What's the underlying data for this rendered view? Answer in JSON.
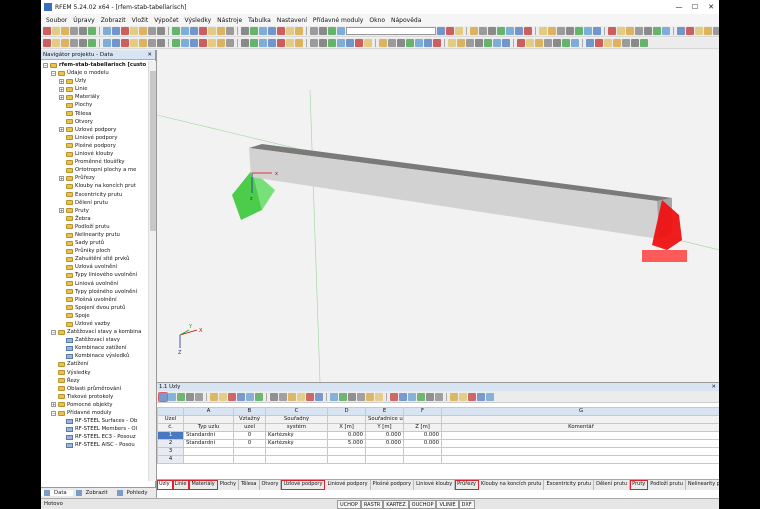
{
  "window": {
    "title": "RFEM 5.24.02 x64 - [rfem-stab-tabellarisch]",
    "min": "—",
    "max": "☐",
    "close": "✕"
  },
  "menu": [
    "Soubor",
    "Úpravy",
    "Zobrazit",
    "Vložit",
    "Výpočet",
    "Výsledky",
    "Nástroje",
    "Tabulka",
    "Nastavení",
    "Přídavné moduly",
    "Okno",
    "Nápověda"
  ],
  "navigator": {
    "title": "Navigátor projektu - Data",
    "items": [
      {
        "label": "rfem-stab-tabellarisch [custo",
        "level": 0,
        "exp": "−",
        "icon": "model",
        "bold": true
      },
      {
        "label": "Údaje o modelu",
        "level": 1,
        "exp": "−",
        "icon": "folder"
      },
      {
        "label": "Uzly",
        "level": 2,
        "exp": "+",
        "icon": "folder"
      },
      {
        "label": "Linie",
        "level": 2,
        "exp": "+",
        "icon": "folder"
      },
      {
        "label": "Materiály",
        "level": 2,
        "exp": "+",
        "icon": "folder"
      },
      {
        "label": "Plochy",
        "level": 2,
        "exp": "",
        "icon": "folder"
      },
      {
        "label": "Tělesa",
        "level": 2,
        "exp": "",
        "icon": "folder"
      },
      {
        "label": "Otvory",
        "level": 2,
        "exp": "",
        "icon": "folder"
      },
      {
        "label": "Uzlové podpory",
        "level": 2,
        "exp": "+",
        "icon": "folder"
      },
      {
        "label": "Liniové podpory",
        "level": 2,
        "exp": "",
        "icon": "folder"
      },
      {
        "label": "Plošné podpory",
        "level": 2,
        "exp": "",
        "icon": "folder"
      },
      {
        "label": "Liniové klouby",
        "level": 2,
        "exp": "",
        "icon": "folder"
      },
      {
        "label": "Proměnné tloušťky",
        "level": 2,
        "exp": "",
        "icon": "folder"
      },
      {
        "label": "Ortotropní plochy a me",
        "level": 2,
        "exp": "",
        "icon": "folder"
      },
      {
        "label": "Průřezy",
        "level": 2,
        "exp": "+",
        "icon": "folder"
      },
      {
        "label": "Klouby na koncích prut",
        "level": 2,
        "exp": "",
        "icon": "folder"
      },
      {
        "label": "Excentricity prutu",
        "level": 2,
        "exp": "",
        "icon": "folder"
      },
      {
        "label": "Dělení prutu",
        "level": 2,
        "exp": "",
        "icon": "folder"
      },
      {
        "label": "Pruty",
        "level": 2,
        "exp": "+",
        "icon": "folder"
      },
      {
        "label": "Žebra",
        "level": 2,
        "exp": "",
        "icon": "folder"
      },
      {
        "label": "Podloží prutu",
        "level": 2,
        "exp": "",
        "icon": "folder"
      },
      {
        "label": "Nelinearity prutu",
        "level": 2,
        "exp": "",
        "icon": "folder"
      },
      {
        "label": "Sady prutů",
        "level": 2,
        "exp": "",
        "icon": "folder"
      },
      {
        "label": "Průniky ploch",
        "level": 2,
        "exp": "",
        "icon": "folder"
      },
      {
        "label": "Zahuštění sítě prvků",
        "level": 2,
        "exp": "",
        "icon": "folder"
      },
      {
        "label": "Uzlová uvolnění",
        "level": 2,
        "exp": "",
        "icon": "folder"
      },
      {
        "label": "Typy liniového uvolnění",
        "level": 2,
        "exp": "",
        "icon": "folder"
      },
      {
        "label": "Liniová uvolnění",
        "level": 2,
        "exp": "",
        "icon": "folder"
      },
      {
        "label": "Typy plošného uvolnění",
        "level": 2,
        "exp": "",
        "icon": "folder"
      },
      {
        "label": "Plošná uvolnění",
        "level": 2,
        "exp": "",
        "icon": "folder"
      },
      {
        "label": "Spojení dvou prutů",
        "level": 2,
        "exp": "",
        "icon": "folder"
      },
      {
        "label": "Spoje",
        "level": 2,
        "exp": "",
        "icon": "folder"
      },
      {
        "label": "Uzlové vazby",
        "level": 2,
        "exp": "",
        "icon": "folder"
      },
      {
        "label": "Zatěžovací stavy a kombina",
        "level": 1,
        "exp": "−",
        "icon": "folder"
      },
      {
        "label": "Zatěžovací stavy",
        "level": 2,
        "exp": "",
        "icon": "item"
      },
      {
        "label": "Kombinace zatížení",
        "level": 2,
        "exp": "",
        "icon": "item"
      },
      {
        "label": "Kombinace výsledků",
        "level": 2,
        "exp": "",
        "icon": "item"
      },
      {
        "label": "Zatížení",
        "level": 1,
        "exp": "",
        "icon": "folder"
      },
      {
        "label": "Výsledky",
        "level": 1,
        "exp": "",
        "icon": "folder"
      },
      {
        "label": "Řezy",
        "level": 1,
        "exp": "",
        "icon": "folder"
      },
      {
        "label": "Oblasti průměrování",
        "level": 1,
        "exp": "",
        "icon": "folder"
      },
      {
        "label": "Tiskové protokoly",
        "level": 1,
        "exp": "",
        "icon": "folder"
      },
      {
        "label": "Pomocné objekty",
        "level": 1,
        "exp": "+",
        "icon": "folder"
      },
      {
        "label": "Přídavné moduly",
        "level": 1,
        "exp": "−",
        "icon": "folder"
      },
      {
        "label": "RF-STEEL Surfaces - Ob",
        "level": 2,
        "exp": "",
        "icon": "item"
      },
      {
        "label": "RF-STEEL Members - Ol",
        "level": 2,
        "exp": "",
        "icon": "item"
      },
      {
        "label": "RF-STEEL EC3 - Posouz",
        "level": 2,
        "exp": "",
        "icon": "item"
      },
      {
        "label": "RF-STEEL AISC - Posou",
        "level": 2,
        "exp": "",
        "icon": "item"
      }
    ],
    "tabs": [
      "Data",
      "Zobrazit",
      "Pohledy"
    ]
  },
  "viewport": {
    "axis_x": "X",
    "axis_y": "Y",
    "axis_z": "Z",
    "gx": "x",
    "gz": "z"
  },
  "table": {
    "title": "1.1 Uzly",
    "col_letters": [
      "",
      "A",
      "B",
      "C",
      "D",
      "E",
      "F",
      "G"
    ],
    "header1": [
      "Uzel",
      "",
      "Vztažný",
      "Souřadný",
      "",
      "Souřadnice uzlu",
      "",
      ""
    ],
    "header2": [
      "č.",
      "Typ uzlu",
      "uzel",
      "systém",
      "X [m]",
      "Y [m]",
      "Z [m]",
      "Komentář"
    ],
    "rows": [
      {
        "no": "1",
        "type": "Standardní",
        "ref": "0",
        "sys": "Kartézský",
        "x": "0.000",
        "y": "0.000",
        "z": "0.000",
        "c": ""
      },
      {
        "no": "2",
        "type": "Standardní",
        "ref": "0",
        "sys": "Kartézský",
        "x": "5.000",
        "y": "0.000",
        "z": "0.000",
        "c": ""
      },
      {
        "no": "3",
        "type": "",
        "ref": "",
        "sys": "",
        "x": "",
        "y": "",
        "z": "",
        "c": ""
      },
      {
        "no": "4",
        "type": "",
        "ref": "",
        "sys": "",
        "x": "",
        "y": "",
        "z": "",
        "c": ""
      }
    ],
    "tabs": [
      {
        "label": "Uzly",
        "hl": true
      },
      {
        "label": "Linie",
        "hl": true
      },
      {
        "label": "Materiály",
        "hl": true
      },
      {
        "label": "Plochy",
        "hl": false
      },
      {
        "label": "Tělesa",
        "hl": false
      },
      {
        "label": "Otvory",
        "hl": false
      },
      {
        "label": "Uzlové podpory",
        "hl": true
      },
      {
        "label": "Liniové podpory",
        "hl": false
      },
      {
        "label": "Plošné podpory",
        "hl": false
      },
      {
        "label": "Liniové klouby",
        "hl": false
      },
      {
        "label": "Průřezy",
        "hl": true
      },
      {
        "label": "Klouby na koncích prutu",
        "hl": false
      },
      {
        "label": "Excentricity prutu",
        "hl": false
      },
      {
        "label": "Dělení prutu",
        "hl": false
      },
      {
        "label": "Pruty",
        "hl": true
      },
      {
        "label": "Podloží prutu",
        "hl": false
      },
      {
        "label": "Nelinearity prutu",
        "hl": false
      }
    ]
  },
  "status": {
    "caption": "Hotovo",
    "buttons": [
      "UCHOP",
      "RASTR",
      "KARTEZ",
      "OUCHOP",
      "VLINIE",
      "DXF"
    ]
  }
}
